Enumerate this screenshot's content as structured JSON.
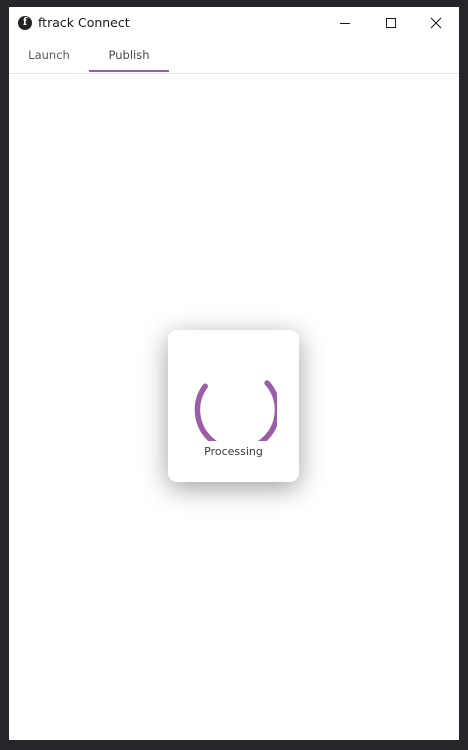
{
  "window": {
    "title": "ftrack Connect",
    "logo_letter": "f",
    "controls": {
      "minimize_icon": "minimize-icon",
      "maximize_icon": "maximize-icon",
      "close_icon": "close-icon"
    }
  },
  "tabs": [
    {
      "label": "Launch",
      "active": false
    },
    {
      "label": "Publish",
      "active": true
    }
  ],
  "overlay": {
    "spinner_icon": "loading-spinner-icon",
    "label": "Processing"
  },
  "colors": {
    "accent": "#9a5ea7",
    "frame": "#252629",
    "background": "#ffffff"
  }
}
